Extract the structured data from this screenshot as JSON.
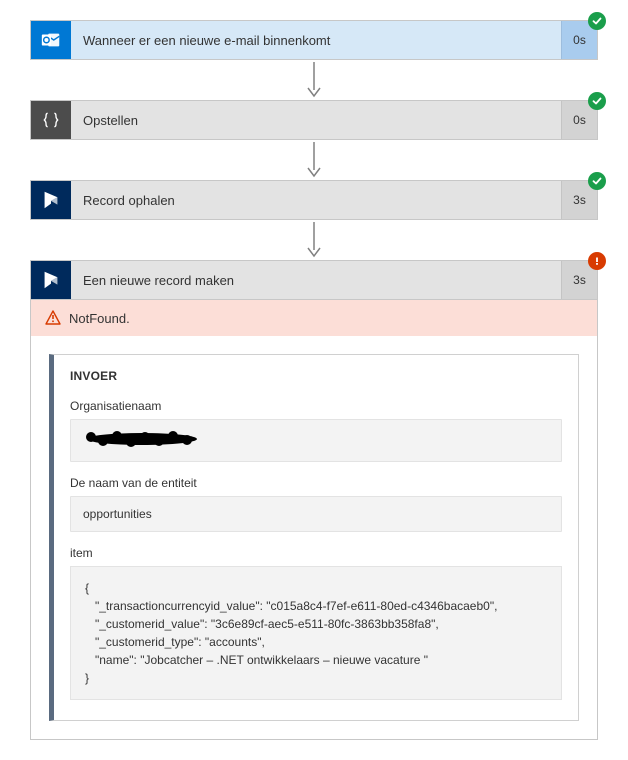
{
  "steps": {
    "s1": {
      "title": "Wanneer er een nieuwe e-mail binnenkomt",
      "time": "0s",
      "status": "success"
    },
    "s2": {
      "title": "Opstellen",
      "time": "0s",
      "status": "success"
    },
    "s3": {
      "title": "Record ophalen",
      "time": "3s",
      "status": "success"
    },
    "s4": {
      "title": "Een nieuwe record maken",
      "time": "3s",
      "status": "error"
    }
  },
  "error_message": "NotFound.",
  "inputs": {
    "heading": "INVOER",
    "labels": {
      "org": "Organisatienaam",
      "entity": "De naam van de entiteit",
      "item": "item"
    },
    "entity_value": "opportunities",
    "item_json": "{\n   \"_transactioncurrencyid_value\": \"c015a8c4-f7ef-e611-80ed-c4346bacaeb0\",\n   \"_customerid_value\": \"3c6e89cf-aec5-e511-80fc-3863bb358fa8\",\n   \"_customerid_type\": \"accounts\",\n   \"name\": \"Jobcatcher – .NET ontwikkelaars – nieuwe vacature \"\n}"
  }
}
